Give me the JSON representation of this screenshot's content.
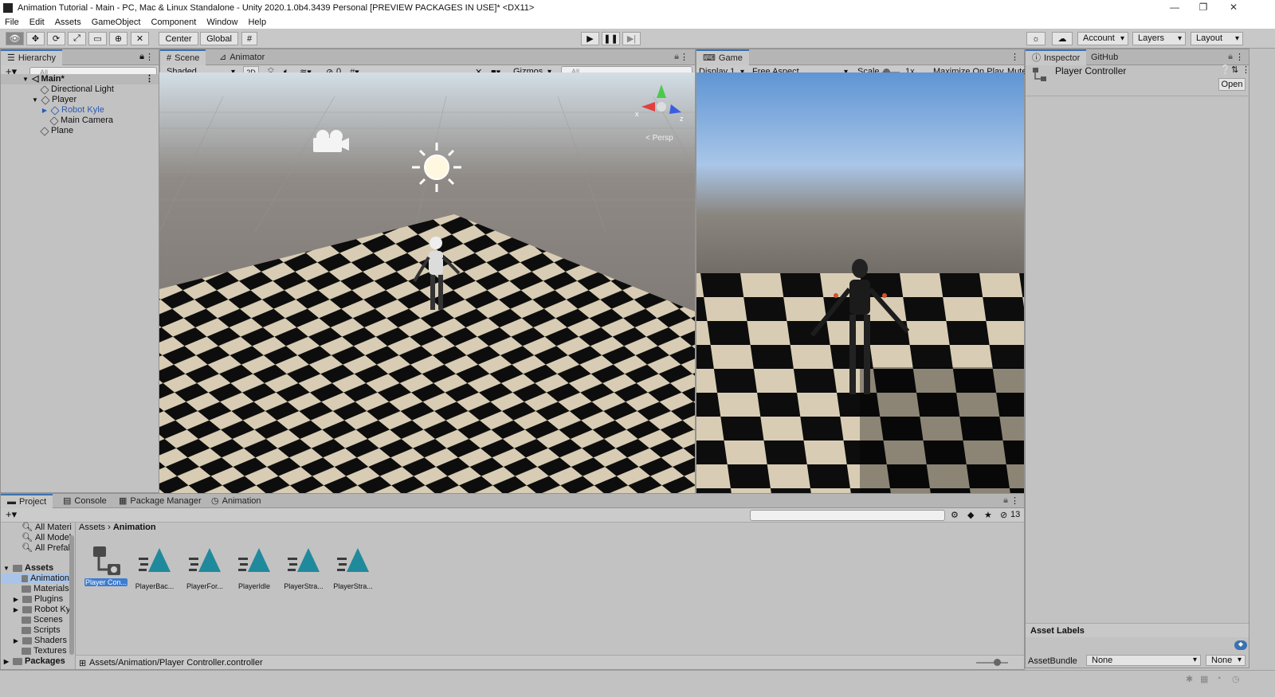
{
  "window": {
    "title": "Animation Tutorial - Main - PC, Mac & Linux Standalone - Unity 2020.1.0b4.3439 Personal [PREVIEW PACKAGES IN USE]* <DX11>"
  },
  "menu": [
    "File",
    "Edit",
    "Assets",
    "GameObject",
    "Component",
    "Window",
    "Help"
  ],
  "toolbar": {
    "pivot": "Center",
    "space": "Global",
    "account": "Account",
    "layers": "Layers",
    "layout": "Layout"
  },
  "hierarchy": {
    "tab": "Hierarchy",
    "search_placeholder": "All",
    "scene": "Main*",
    "items": [
      "Directional Light",
      "Player",
      "Robot Kyle",
      "Main Camera",
      "Plane"
    ]
  },
  "scene": {
    "tabs": [
      "Scene",
      "Animator"
    ],
    "shading": "Shaded",
    "mode2d": "2D",
    "hidden_count": "0",
    "gizmos": "Gizmos",
    "search_placeholder": "All",
    "persp": "< Persp",
    "axis_x": "x",
    "axis_z": "z"
  },
  "game": {
    "tab": "Game",
    "display": "Display 1",
    "aspect": "Free Aspect",
    "scale_label": "Scale",
    "scale_value": "1x",
    "maximize": "Maximize On Play",
    "mute": "Mute"
  },
  "inspector": {
    "tabs": [
      "Inspector",
      "GitHub"
    ],
    "object": "Player Controller",
    "open": "Open",
    "asset_labels": "Asset Labels",
    "assetbundle_label": "AssetBundle",
    "assetbundle_value": "None",
    "variant_value": "None"
  },
  "project": {
    "tabs": [
      "Project",
      "Console",
      "Package Manager",
      "Animation"
    ],
    "hidden_count": "13",
    "favorites": [
      "All Materi",
      "All Model",
      "All Prefab"
    ],
    "assets_root": "Assets",
    "folders": [
      "Animation",
      "Materials",
      "Plugins",
      "Robot Kyl",
      "Scenes",
      "Scripts",
      "Shaders",
      "Textures"
    ],
    "packages": "Packages",
    "breadcrumb": [
      "Assets",
      "Animation"
    ],
    "assets": [
      "Player Con...",
      "PlayerBac...",
      "PlayerFor...",
      "PlayerIdle",
      "PlayerStra...",
      "PlayerStra..."
    ],
    "path": "Assets/Animation/Player Controller.controller"
  },
  "colors": {
    "accent": "#3a72b0",
    "selection": "#3d7dd1",
    "anim_clip": "#1f8a9c"
  }
}
